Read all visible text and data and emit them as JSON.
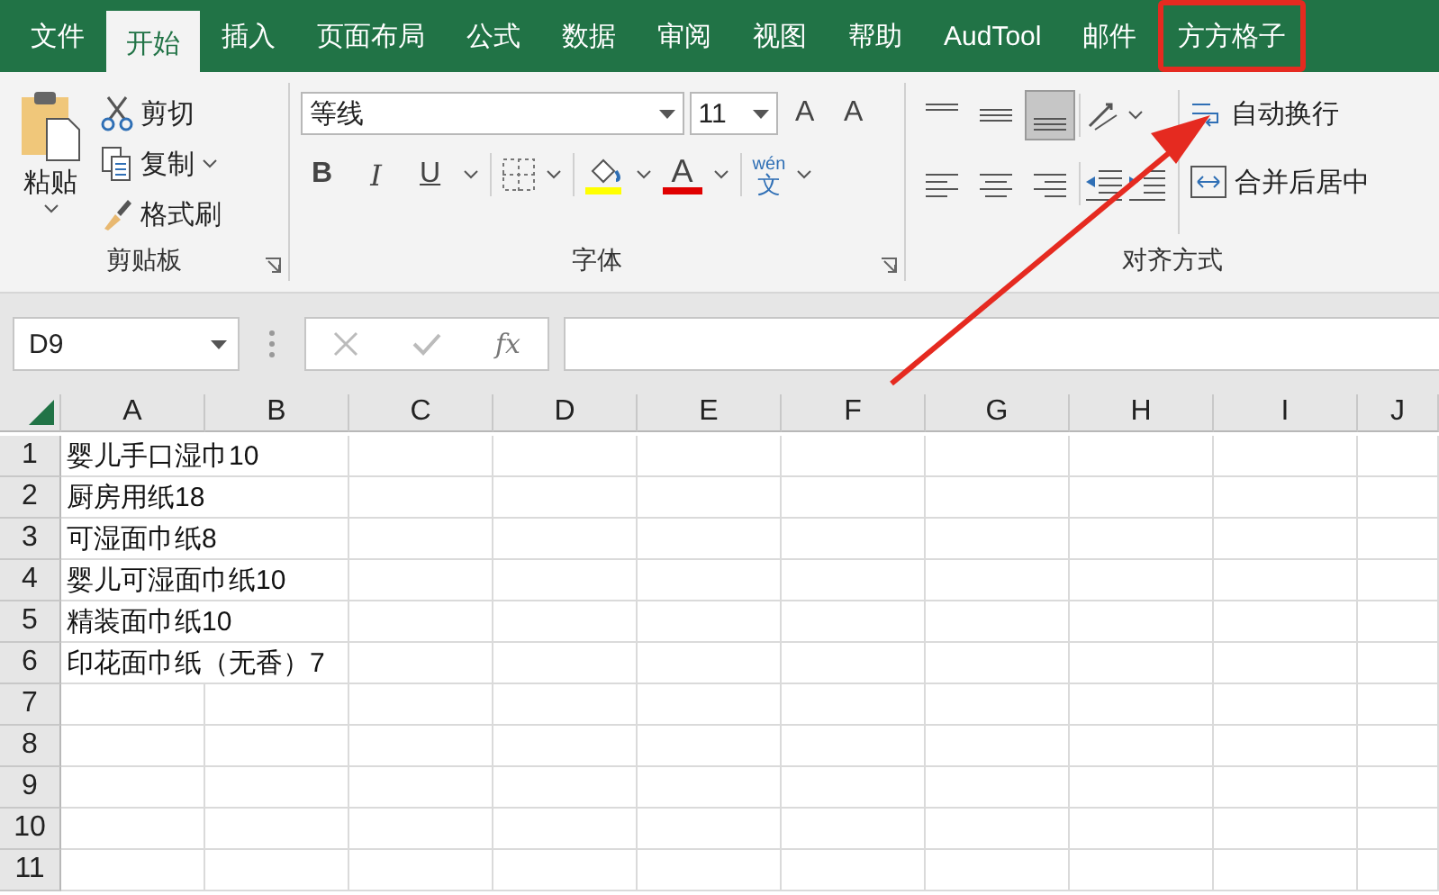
{
  "tabs": [
    {
      "label": "文件",
      "selected": false,
      "highlighted": false
    },
    {
      "label": "开始",
      "selected": true,
      "highlighted": false
    },
    {
      "label": "插入",
      "selected": false,
      "highlighted": false
    },
    {
      "label": "页面布局",
      "selected": false,
      "highlighted": false
    },
    {
      "label": "公式",
      "selected": false,
      "highlighted": false
    },
    {
      "label": "数据",
      "selected": false,
      "highlighted": false
    },
    {
      "label": "审阅",
      "selected": false,
      "highlighted": false
    },
    {
      "label": "视图",
      "selected": false,
      "highlighted": false
    },
    {
      "label": "帮助",
      "selected": false,
      "highlighted": false
    },
    {
      "label": "AudTool",
      "selected": false,
      "highlighted": false
    },
    {
      "label": "邮件",
      "selected": false,
      "highlighted": false
    },
    {
      "label": "方方格子",
      "selected": false,
      "highlighted": true
    }
  ],
  "ribbon": {
    "clipboard": {
      "paste": "粘贴",
      "cut": "剪切",
      "copy": "复制",
      "format_painter": "格式刷",
      "label": "剪贴板"
    },
    "font": {
      "font_name": "等线",
      "font_size": "11",
      "grow": "A",
      "shrink": "A",
      "bold": "B",
      "italic": "I",
      "underline": "U",
      "font_color": "A",
      "phonetic_top": "wén",
      "phonetic_bottom": "文",
      "label": "字体"
    },
    "alignment": {
      "vertical": [
        {
          "kind": "top",
          "selected": false
        },
        {
          "kind": "middle",
          "selected": false
        },
        {
          "kind": "bottom",
          "selected": true
        }
      ],
      "wrap_text": "自动换行",
      "merge_center": "合并后居中",
      "label": "对齐方式"
    }
  },
  "formula_bar": {
    "name_box": "D9",
    "fx": "fx"
  },
  "sheet": {
    "columns": [
      "A",
      "B",
      "C",
      "D",
      "E",
      "F",
      "G",
      "H",
      "I",
      "J"
    ],
    "rows": [
      {
        "number": "1",
        "cells": [
          "婴儿手口湿巾10"
        ]
      },
      {
        "number": "2",
        "cells": [
          "厨房用纸18"
        ]
      },
      {
        "number": "3",
        "cells": [
          "可湿面巾纸8"
        ]
      },
      {
        "number": "4",
        "cells": [
          "婴儿可湿面巾纸10"
        ]
      },
      {
        "number": "5",
        "cells": [
          "精装面巾纸10"
        ]
      },
      {
        "number": "6",
        "cells": [
          "印花面巾纸（无香）7"
        ]
      },
      {
        "number": "7",
        "cells": []
      },
      {
        "number": "8",
        "cells": []
      },
      {
        "number": "9",
        "cells": []
      },
      {
        "number": "10",
        "cells": []
      },
      {
        "number": "11",
        "cells": []
      }
    ]
  }
}
